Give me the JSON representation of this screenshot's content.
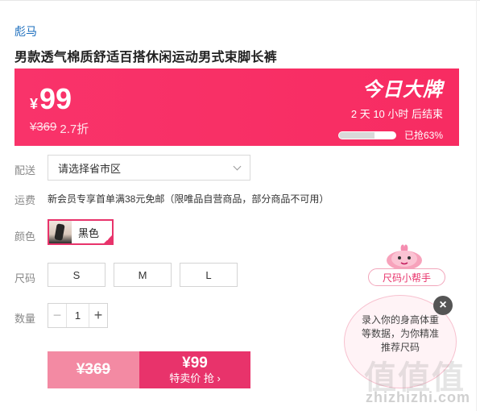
{
  "product": {
    "brand": "彪马",
    "title": "男款透气棉质舒适百搭休闲运动男式束脚长裤"
  },
  "price_banner": {
    "currency": "¥",
    "price": "99",
    "original_price": "¥369",
    "discount": "2.7折",
    "promo_title": "今日大牌",
    "countdown": "2 天 10 小时 后结束",
    "sold_label": "已抢63%",
    "sold_percent": 63,
    "color": "#f9336a"
  },
  "delivery": {
    "label": "配送",
    "placeholder": "请选择省市区"
  },
  "shipping": {
    "label": "运费",
    "text": "新会员专享首单满38元免邮（限唯品自营商品，部分商品不可用）"
  },
  "color": {
    "label": "颜色",
    "selected": "黑色"
  },
  "size": {
    "label": "尺码",
    "options": [
      "S",
      "M",
      "L"
    ]
  },
  "quantity": {
    "label": "数量",
    "value": "1",
    "minus": "−",
    "plus": "+"
  },
  "buy": {
    "original_price": "¥369",
    "price": "¥99",
    "action": "特卖价 抢 ›",
    "accent": "#e8336b"
  },
  "size_helper": {
    "tag": "尺码小帮手",
    "message": "录入你的身高体重等数据，为你精准推荐尺码",
    "close": "×"
  },
  "watermark": {
    "big": "值值值",
    "small": "zhizhizhi.com"
  }
}
